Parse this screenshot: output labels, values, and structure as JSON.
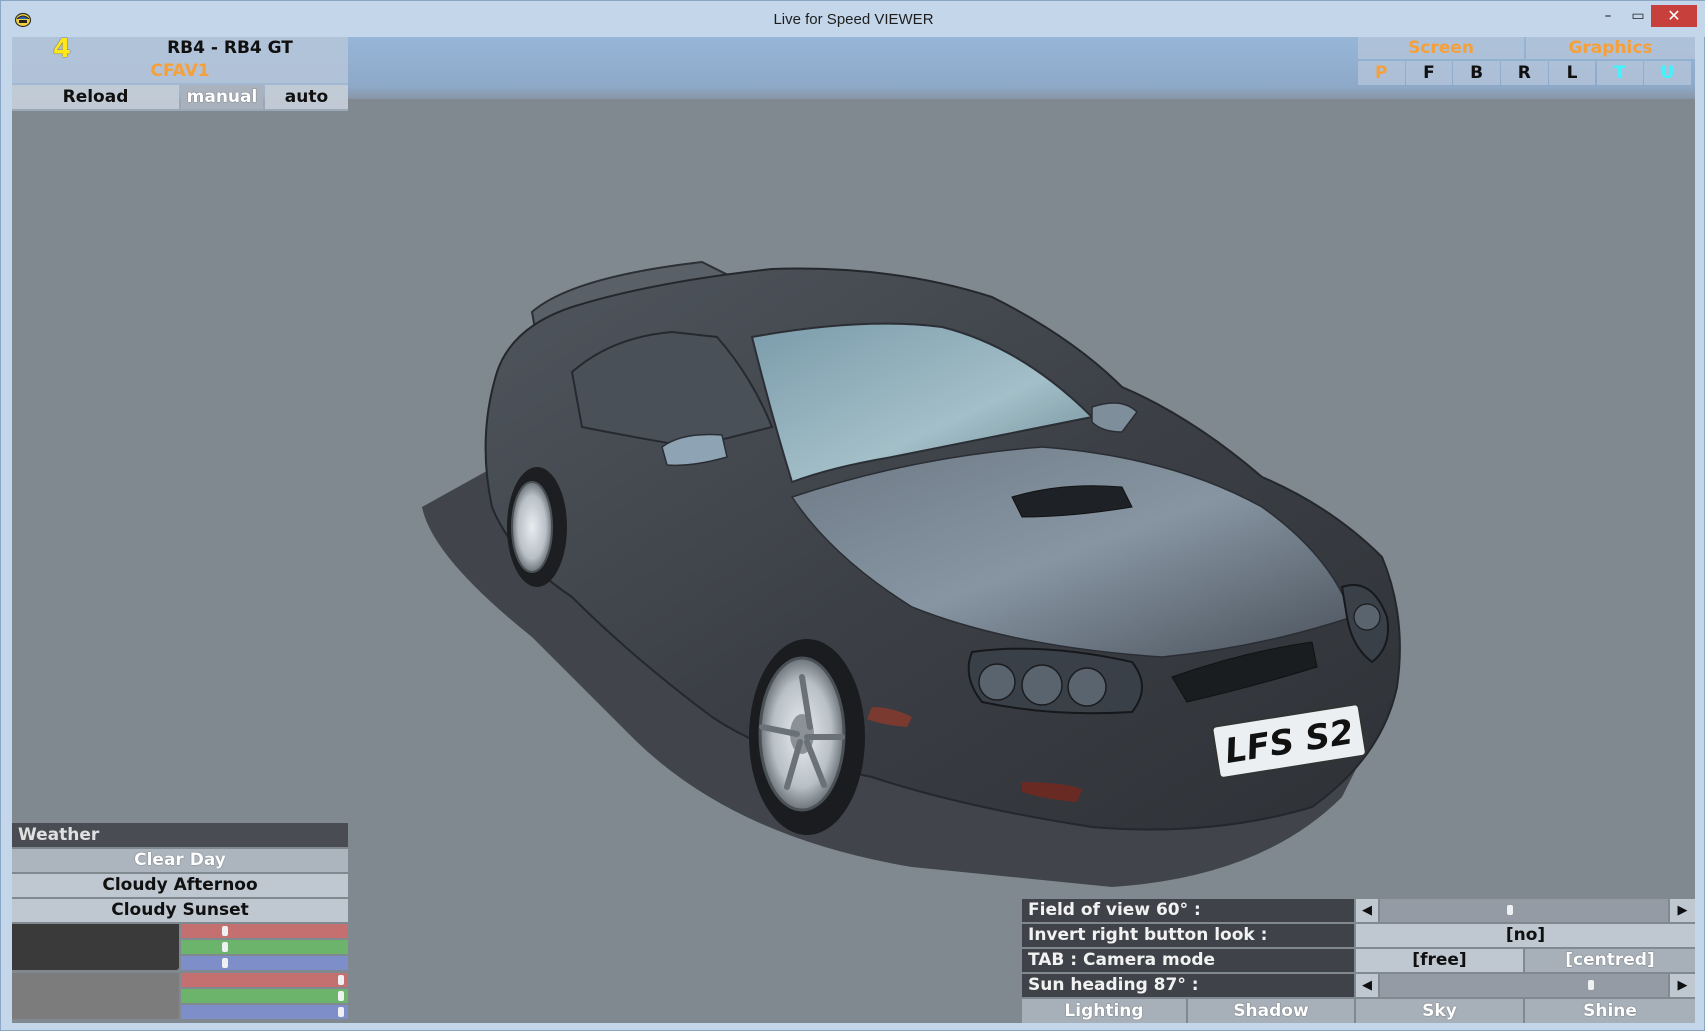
{
  "window": {
    "title": "Live for Speed VIEWER",
    "minimize_symbol": "–",
    "maximize_symbol": "▭",
    "close_symbol": "✕",
    "icon": "lfs-helmet-icon"
  },
  "car_panel": {
    "number": "4",
    "car_name": "RB4 - RB4 GT",
    "skin_name": "CFAV1",
    "reload_label": "Reload",
    "manual_label": "manual",
    "auto_label": "auto",
    "selected_mode": "manual"
  },
  "view_panel": {
    "screen_label": "Screen",
    "graphics_label": "Graphics",
    "view_buttons": [
      {
        "label": "P",
        "state": "active"
      },
      {
        "label": "F",
        "state": "normal"
      },
      {
        "label": "B",
        "state": "normal"
      },
      {
        "label": "R",
        "state": "normal"
      },
      {
        "label": "L",
        "state": "normal"
      },
      {
        "label": "T",
        "state": "highlight"
      },
      {
        "label": "U",
        "state": "highlight"
      }
    ]
  },
  "car_scene": {
    "plate_text": "LFS S2",
    "body_color": "#3c4046",
    "shadow_color": "#3a3e44"
  },
  "weather_panel": {
    "title": "Weather",
    "options": [
      {
        "label": "Clear Day",
        "selected": true
      },
      {
        "label": "Cloudy Afternoo",
        "selected": false
      },
      {
        "label": "Cloudy Sunset",
        "selected": false
      }
    ],
    "color_rows": [
      {
        "swatch": "#3a3a3a",
        "red": 0.25,
        "green": 0.25,
        "blue": 0.25
      },
      {
        "swatch": "#7c7c7c",
        "red": 0.98,
        "green": 0.98,
        "blue": 0.98
      }
    ],
    "channel_colors": {
      "red": "#c47070",
      "green": "#6cb46c",
      "blue": "#7e8ec8"
    }
  },
  "camera_panel": {
    "fov_label": "Field of view 60° :",
    "fov_value": 0.45,
    "invert_label": "Invert right button look :",
    "invert_value": "[no]",
    "tab_label": "TAB : Camera mode",
    "tab_free": "[free]",
    "tab_centred": "[centred]",
    "sun_label": "Sun heading 87° :",
    "sun_value": 0.74,
    "arrow_left": "◀",
    "arrow_right": "▶",
    "tabs": [
      "Lighting",
      "Shadow",
      "Sky",
      "Shine"
    ]
  },
  "colors": {
    "orange": "#f6a03c",
    "cyan": "#3ff4ff",
    "yellow": "#ffe81a",
    "close_red": "#c7403b"
  }
}
